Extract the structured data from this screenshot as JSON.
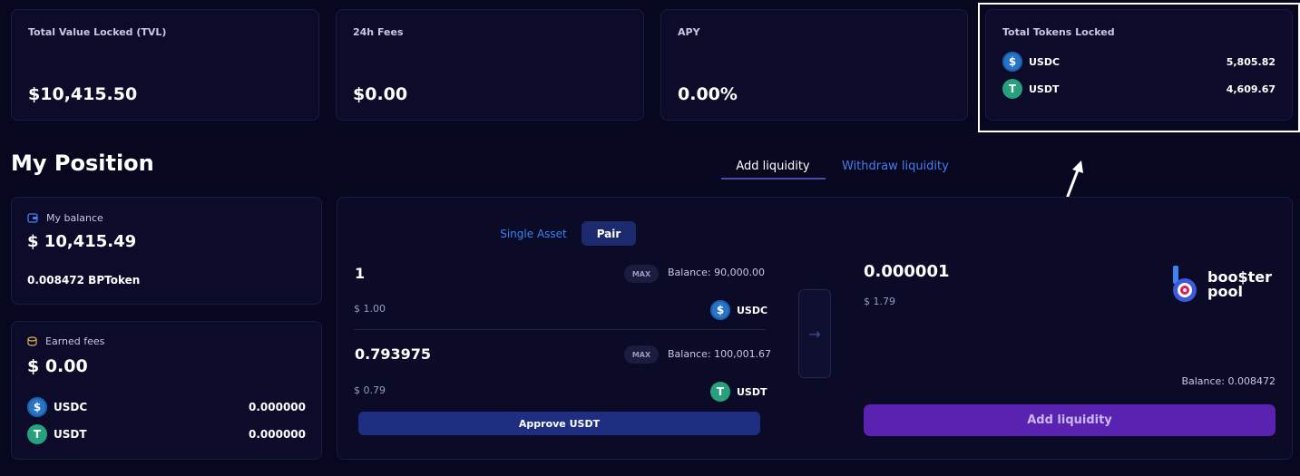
{
  "stats": {
    "tvl": {
      "label": "Total Value Locked (TVL)",
      "value": "$10,415.50"
    },
    "fees": {
      "label": "24h Fees",
      "value": "$0.00"
    },
    "apy": {
      "label": "APY",
      "value": "0.00%"
    },
    "locked": {
      "label": "Total Tokens Locked",
      "tokens": [
        {
          "name": "USDC",
          "amount": "5,805.82"
        },
        {
          "name": "USDT",
          "amount": "4,609.67"
        }
      ]
    }
  },
  "position": {
    "title": "My Position",
    "balance_label": "My balance",
    "balance_value": "$ 10,415.49",
    "bptoken": "0.008472 BPToken",
    "earned_label": "Earned fees",
    "earned_value": "$ 0.00",
    "earned_tokens": [
      {
        "name": "USDC",
        "amount": "0.000000"
      },
      {
        "name": "USDT",
        "amount": "0.000000"
      }
    ]
  },
  "tabs": {
    "add": "Add liquidity",
    "withdraw": "Withdraw liquidity"
  },
  "form": {
    "mode_single": "Single Asset",
    "mode_pair": "Pair",
    "max_label": "MAX",
    "input1": {
      "value": "1",
      "balance": "Balance: 90,000.00",
      "usd": "$ 1.00",
      "token": "USDC"
    },
    "input2": {
      "value": "0.793975",
      "balance": "Balance: 100,001.67",
      "usd": "$ 0.79",
      "token": "USDT"
    },
    "approve_label": "Approve USDT",
    "output": {
      "value": "0.000001",
      "usd": "$ 1.79",
      "balance": "Balance: 0.008472"
    },
    "add_button": "Add liquidity",
    "logo_line1": "boo$ter",
    "logo_line2": "pool"
  },
  "colors": {
    "background": "#070720",
    "card": "#0c0c2a",
    "accent_blue": "#3b82f6",
    "add_button": "#5a22b0",
    "usdc": "#2775ca",
    "usdt": "#26a17b"
  }
}
